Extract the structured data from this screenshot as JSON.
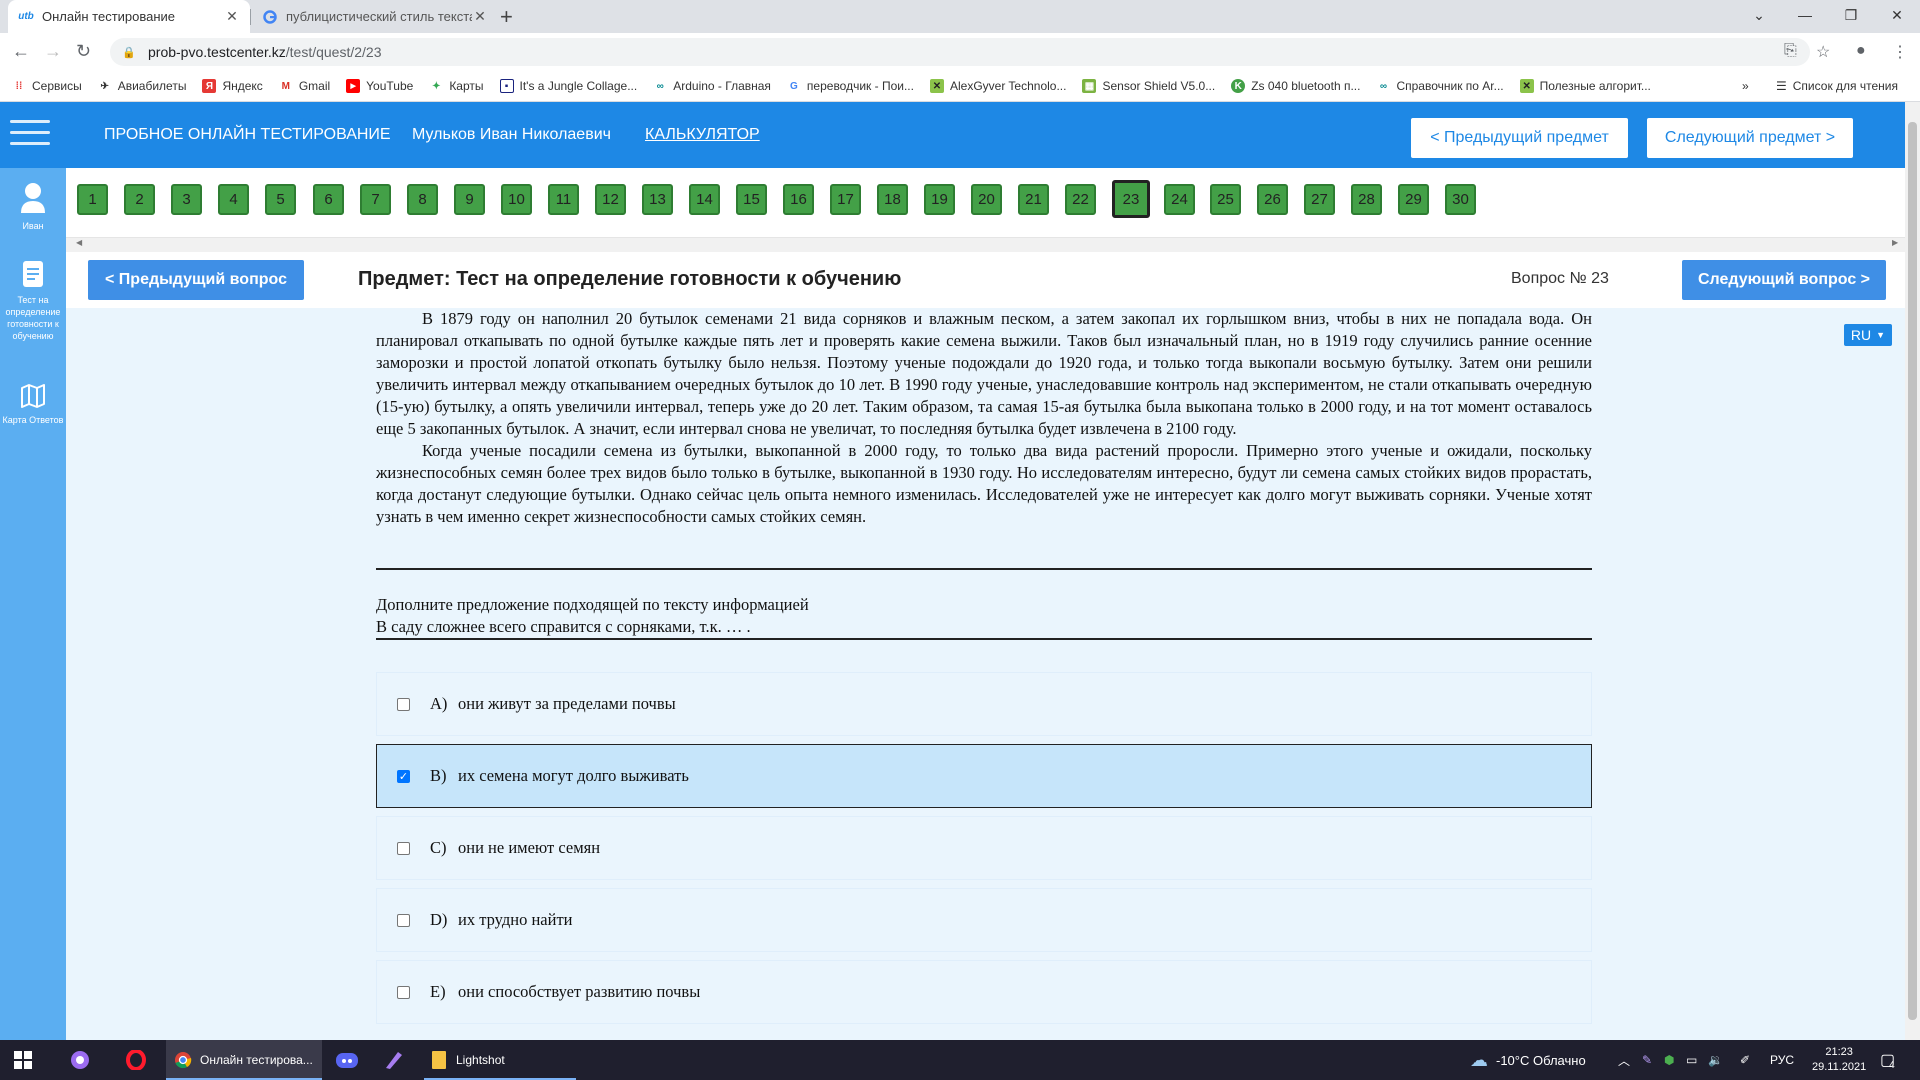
{
  "browser": {
    "tabs": [
      {
        "title": "Онлайн тестирование",
        "active": true,
        "favicon": "utb-logo"
      },
      {
        "title": "публицистический стиль текста",
        "active": false,
        "favicon": "google-g"
      }
    ],
    "url_host": "prob-pvo.testcenter.kz",
    "url_path": "/test/quest/2/23",
    "bookmarks": [
      {
        "label": "Сервисы",
        "icon": "apps-grid-icon"
      },
      {
        "label": "Авиабилеты",
        "icon": "plane-icon"
      },
      {
        "label": "Яндекс",
        "icon": "yandex-icon"
      },
      {
        "label": "Gmail",
        "icon": "gmail-icon"
      },
      {
        "label": "YouTube",
        "icon": "youtube-icon"
      },
      {
        "label": "Карты",
        "icon": "maps-icon"
      },
      {
        "label": "It's a Jungle Collage...",
        "icon": "bookmark-icon"
      },
      {
        "label": "Arduino - Главная",
        "icon": "arduino-icon"
      },
      {
        "label": "переводчик - Пои...",
        "icon": "google-icon"
      },
      {
        "label": "AlexGyver Technolo...",
        "icon": "alexgyver-icon"
      },
      {
        "label": "Sensor Shield V5.0...",
        "icon": "grid-icon"
      },
      {
        "label": "Zs 040 bluetooth п...",
        "icon": "k-icon"
      },
      {
        "label": "Справочник по Ar...",
        "icon": "arduino-icon"
      },
      {
        "label": "Полезные алгорит...",
        "icon": "alexgyver-icon"
      }
    ],
    "bookmarks_more": "»",
    "reading_list": "Список для чтения"
  },
  "header": {
    "title": "ПРОБНОЕ ОНЛАЙН ТЕСТИРОВАНИЕ",
    "user": "Мульков Иван Николаевич",
    "calculator": "КАЛЬКУЛЯТОР",
    "prev_subject": "< Предыдущий предмет",
    "next_subject": "Следующий предмет >"
  },
  "sidebar": {
    "user_label": "Иван",
    "test_label": "Тест на определение готовности к обучению",
    "map_label": "Карта Ответов"
  },
  "questions": [
    "1",
    "2",
    "3",
    "4",
    "5",
    "6",
    "7",
    "8",
    "9",
    "10",
    "11",
    "12",
    "13",
    "14",
    "15",
    "16",
    "17",
    "18",
    "19",
    "20",
    "21",
    "22",
    "23",
    "24",
    "25",
    "26",
    "27",
    "28",
    "29",
    "30"
  ],
  "current_question": "23",
  "nav": {
    "prev_question": "< Предыдущий вопрос",
    "next_question": "Следующий вопрос >",
    "subject": "Предмет: Тест на определение готовности к обучению",
    "question_label": "Вопрос № 23",
    "language": "RU"
  },
  "passage": {
    "p1": "В 1879 году он наполнил 20 бутылок семенами 21 вида сорняков и влажным песком, а затем закопал их горлышком вниз, чтобы в них не попадала вода. Он планировал откапывать по одной бутылке каждые пять лет и проверять какие семена выжили. Таков был изначальный план, но в 1919 году случились ранние осенние заморозки и простой лопатой откопать бутылку было нельзя. Поэтому ученые подождали до 1920 года, и только тогда выкопали восьмую бутылку. Затем они решили увеличить интервал между откапыванием очередных бутылок до 10 лет. В 1990 году ученые, унаследовавшие контроль над экспериментом, не стали откапывать очередную (15-ую) бутылку, а опять увеличили интервал, теперь уже до 20 лет. Таким образом, та самая 15-ая бутылка была выкопана только в 2000 году, и на тот момент оставалось еще 5 закопанных бутылок. А значит, если интервал снова не увеличат, то последняя бутылка будет извлечена в 2100 году.",
    "p2": "Когда ученые посадили семена из бутылки, выкопанной в 2000 году, то только два вида растений проросли. Примерно этого ученые и ожидали, поскольку жизнеспособных семян более трех видов было только в бутылке, выкопанной в 1930 году. Но исследователям интересно, будут ли семена самых стойких видов прорастать, когда достанут следующие бутылки. Однако сейчас цель опыта немного изменилась. Исследователей уже не интересует как долго могут выживать сорняки. Ученые хотят узнать в чем именно секрет жизнеспособности самых стойких семян."
  },
  "prompt": {
    "line1": "Дополните предложение подходящей по тексту информацией",
    "line2": "В саду сложнее всего справится с сорняками, т.к. … ."
  },
  "options": [
    {
      "letter": "A)",
      "text": "они живут за пределами почвы",
      "checked": false
    },
    {
      "letter": "B)",
      "text": "их семена могут долго выживать",
      "checked": true
    },
    {
      "letter": "C)",
      "text": "они не имеют семян",
      "checked": false
    },
    {
      "letter": "D)",
      "text": "их трудно найти",
      "checked": false
    },
    {
      "letter": "E)",
      "text": "они способствует развитию почвы",
      "checked": false
    }
  ],
  "taskbar": {
    "apps": [
      {
        "label": "Онлайн тестирова...",
        "icon": "chrome-icon"
      },
      {
        "label": "Lightshot",
        "icon": "lightshot-icon"
      }
    ],
    "weather": "-10°C Облачно",
    "lang": "РУС",
    "time": "21:23",
    "date": "29.11.2021",
    "notifications": "4"
  },
  "colors": {
    "header": "#1e88e5",
    "sidebar": "#5baef1",
    "question_green": "#43a047",
    "main_bg": "#eaf5fd",
    "selected": "#c6e5fa"
  }
}
